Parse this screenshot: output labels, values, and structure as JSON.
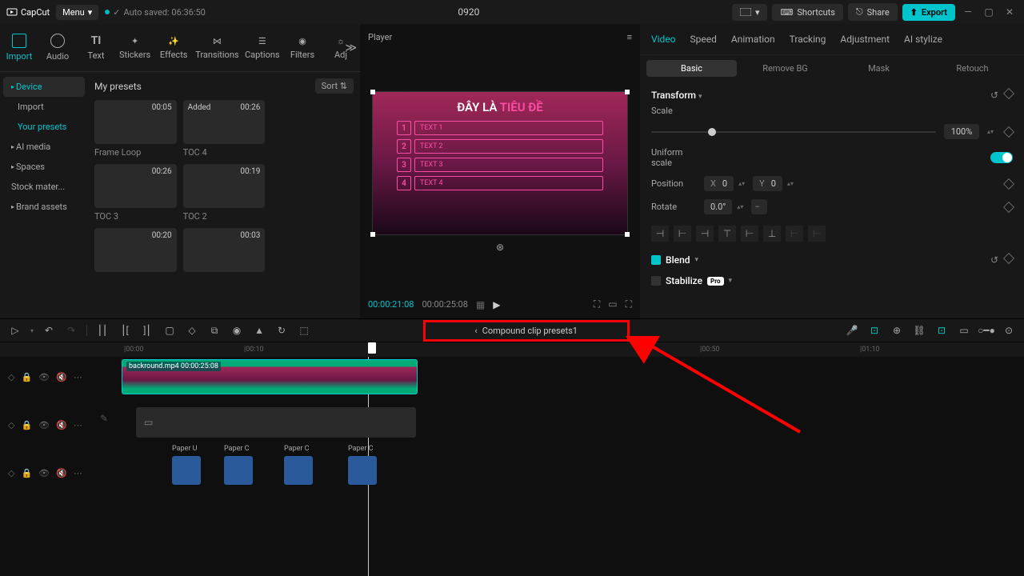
{
  "app": {
    "name": "CapCut",
    "menu": "Menu",
    "autosave": "Auto saved: 06:36:50",
    "project": "0920"
  },
  "titlebar": {
    "shortcuts": "Shortcuts",
    "share": "Share",
    "export": "Export"
  },
  "tabs": {
    "import": "Import",
    "audio": "Audio",
    "text": "Text",
    "stickers": "Stickers",
    "effects": "Effects",
    "transitions": "Transitions",
    "captions": "Captions",
    "filters": "Filters",
    "adj": "Adj"
  },
  "sidebar": {
    "device": "Device",
    "import": "Import",
    "yourpresets": "Your presets",
    "aimedia": "AI media",
    "spaces": "Spaces",
    "stockmat": "Stock mater...",
    "brandassets": "Brand assets"
  },
  "presets": {
    "title": "My presets",
    "sort": "Sort",
    "items": [
      {
        "time": "00:05",
        "label": "Frame Loop"
      },
      {
        "time": "00:26",
        "label": "TOC 4",
        "badge": "Added"
      },
      {
        "time": "",
        "label": ""
      },
      {
        "time": "00:26",
        "label": "TOC 3"
      },
      {
        "time": "00:19",
        "label": "TOC 2"
      },
      {
        "time": "",
        "label": ""
      },
      {
        "time": "00:20",
        "label": ""
      },
      {
        "time": "00:03",
        "label": ""
      }
    ]
  },
  "player": {
    "title": "Player",
    "currentTime": "00:00:21:08",
    "duration": "00:00:25:08",
    "preview": {
      "title1": "ĐÂY LÀ",
      "title2": "TIÊU ĐỀ",
      "rows": [
        {
          "n": "1",
          "t": "TEXT 1"
        },
        {
          "n": "2",
          "t": "TEXT 2"
        },
        {
          "n": "3",
          "t": "TEXT 3"
        },
        {
          "n": "4",
          "t": "TEXT 4"
        }
      ]
    }
  },
  "right": {
    "tabs": {
      "video": "Video",
      "speed": "Speed",
      "animation": "Animation",
      "tracking": "Tracking",
      "adjustment": "Adjustment",
      "aistylize": "AI stylize"
    },
    "subtabs": {
      "basic": "Basic",
      "removebg": "Remove BG",
      "mask": "Mask",
      "retouch": "Retouch"
    },
    "transform": {
      "title": "Transform",
      "scale": "Scale",
      "scaleVal": "100%",
      "uniform": "Uniform scale",
      "position": "Position",
      "x": "X",
      "xVal": "0",
      "y": "Y",
      "yVal": "0",
      "rotate": "Rotate",
      "rotateVal": "0.0°"
    },
    "blend": "Blend",
    "stabilize": "Stabilize",
    "pro": "Pro"
  },
  "compound": "Compound clip presets1",
  "timeline": {
    "marks": [
      "|00:00",
      "|00:10",
      "|00:50",
      "|01:10"
    ],
    "clip1": "backround.mp4   00:00:25:08",
    "audio": [
      "Paper U",
      "Paper C",
      "Paper C",
      "Paper C"
    ]
  }
}
